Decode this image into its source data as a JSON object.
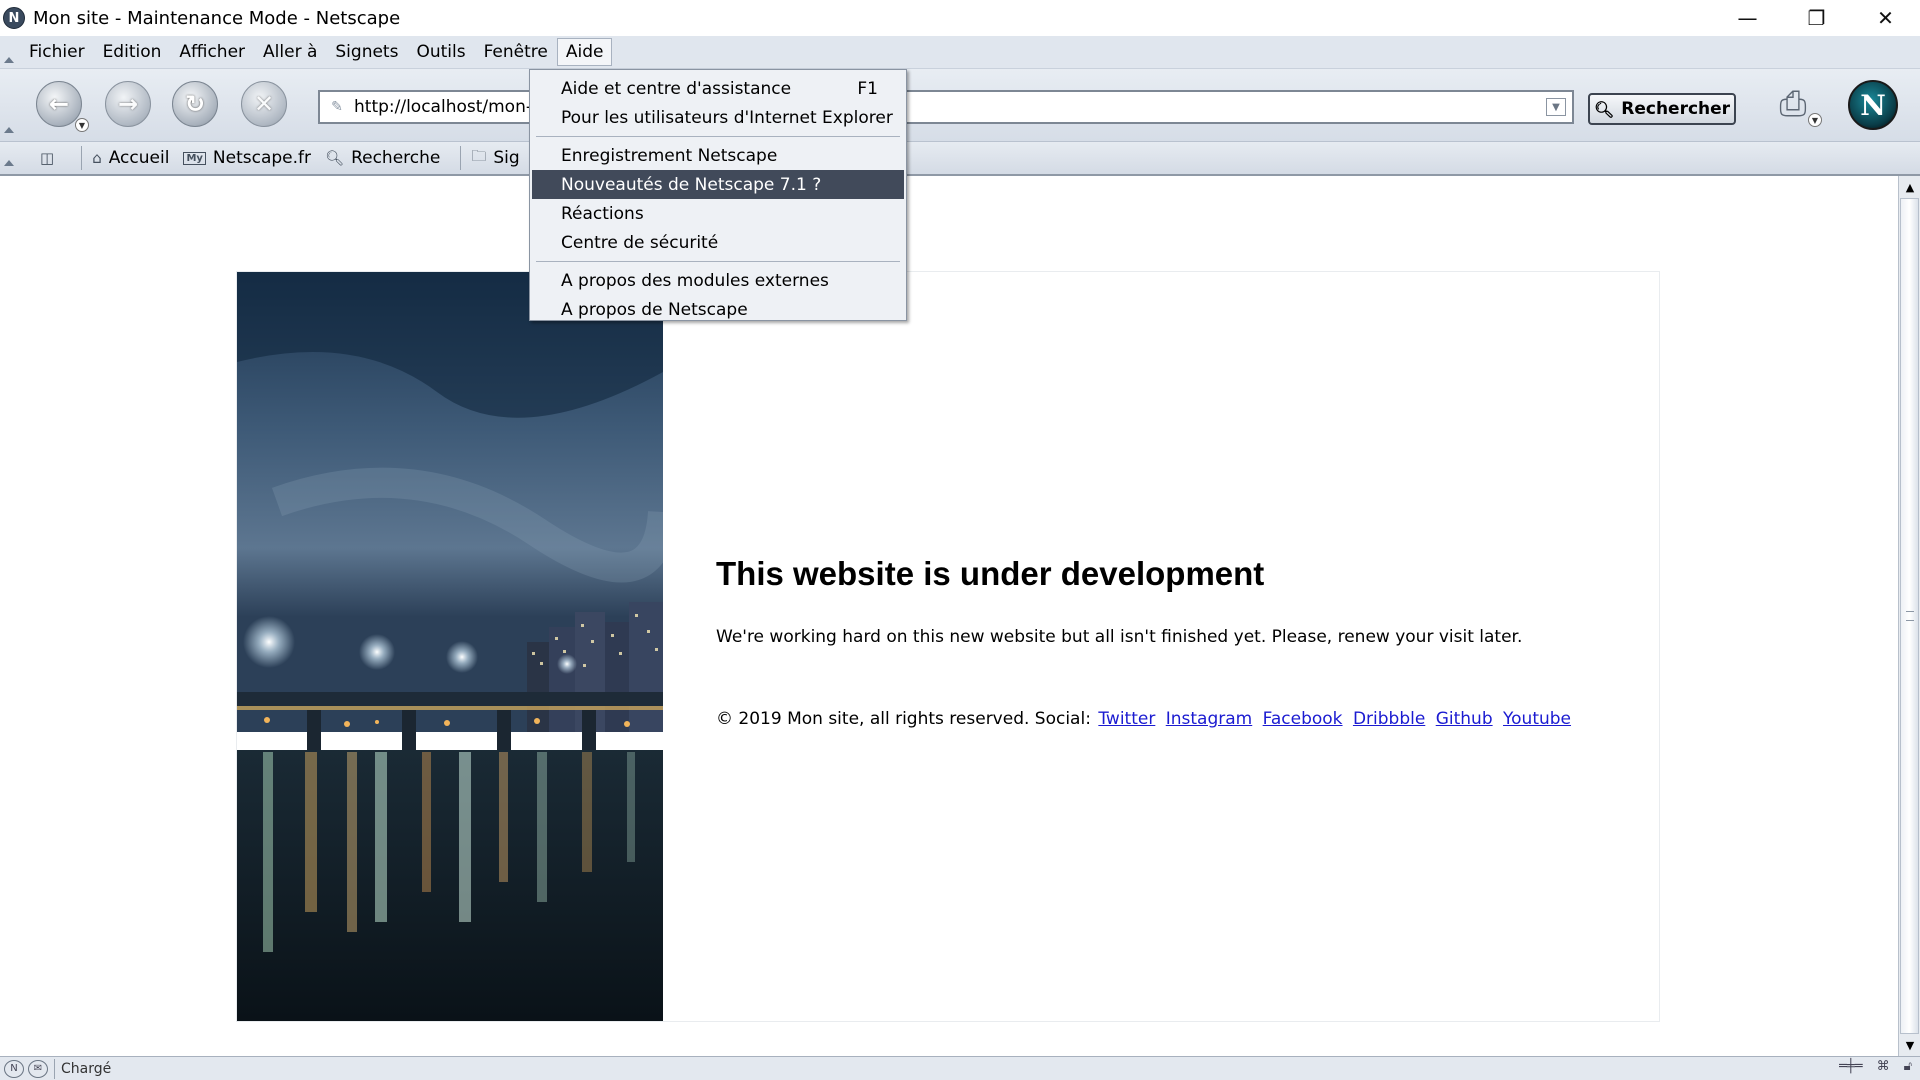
{
  "window": {
    "title": "Mon site - Maintenance Mode - Netscape",
    "app_icon": "netscape-n-icon",
    "controls": [
      "minimize-icon",
      "restore-icon",
      "close-icon"
    ]
  },
  "menubar": {
    "items": [
      {
        "label": "Fichier"
      },
      {
        "label": "Edition"
      },
      {
        "label": "Afficher"
      },
      {
        "label": "Aller à"
      },
      {
        "label": "Signets"
      },
      {
        "label": "Outils"
      },
      {
        "label": "Fenêtre"
      },
      {
        "label": "Aide",
        "open": true
      }
    ]
  },
  "navbar": {
    "url": "http://localhost/mon-site/",
    "search_label": "Rechercher",
    "buttons": [
      "back-icon",
      "forward-icon",
      "reload-icon",
      "stop-icon",
      "print-icon"
    ]
  },
  "bookmarks": {
    "items": [
      {
        "label": "Accueil",
        "icon": "home-icon"
      },
      {
        "label": "Netscape.fr",
        "icon": "my-netscape-icon"
      },
      {
        "label": "Recherche",
        "icon": "search-icon"
      },
      {
        "label": "Sig",
        "icon": "folder-icon"
      }
    ]
  },
  "help_menu": {
    "groups": [
      [
        {
          "label": "Aide et centre d'assistance",
          "shortcut": "F1"
        },
        {
          "label": "Pour les utilisateurs d'Internet Explorer"
        }
      ],
      [
        {
          "label": "Enregistrement Netscape"
        },
        {
          "label": "Nouveautés de Netscape 7.1 ?",
          "highlighted": true
        },
        {
          "label": "Réactions"
        },
        {
          "label": "Centre de sécurité"
        }
      ],
      [
        {
          "label": "A propos des modules externes"
        },
        {
          "label": "A propos de Netscape"
        }
      ]
    ]
  },
  "page": {
    "heading": "This website is under development",
    "description": "We're working hard on this new website but all isn't finished yet. Please, renew your visit later.",
    "footer_text": "© 2019 Mon site, all rights reserved. Social:",
    "social_links": [
      "Twitter",
      "Instagram",
      "Facebook",
      "Dribbble",
      "Github",
      "Youtube"
    ]
  },
  "statusbar": {
    "text": "Chargé"
  },
  "colors": {
    "chrome": "#e0e6ee",
    "menu_highlight": "#414a5a",
    "link": "#1b1bd1"
  }
}
